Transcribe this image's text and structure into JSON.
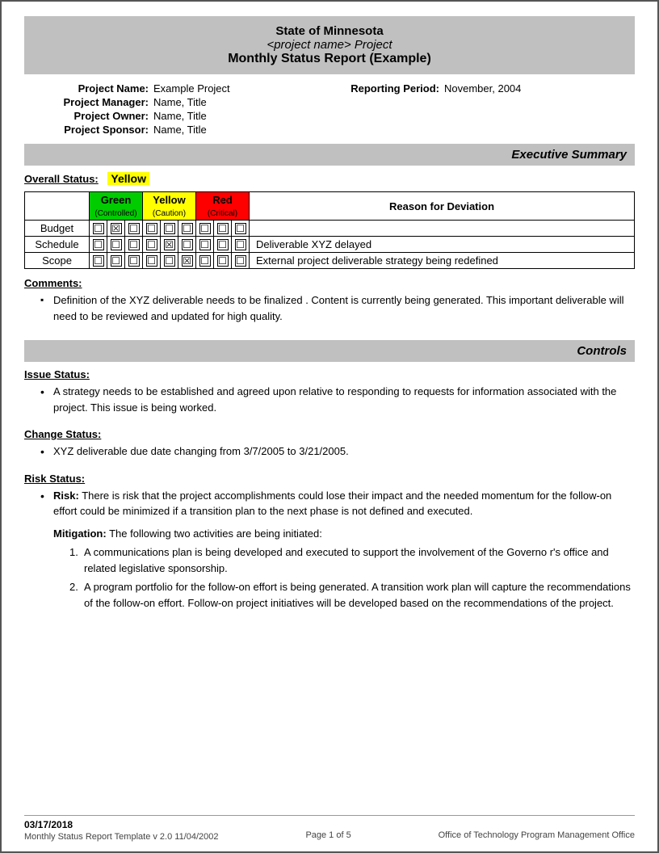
{
  "header": {
    "line1": "State of Minnesota",
    "line2": "<project name> Project",
    "line3": "Monthly Status Report (Example)"
  },
  "projectInfo": {
    "projectNameLabel": "Project Name:",
    "projectNameValue": "Example Project",
    "reportingPeriodLabel": "Reporting Period:",
    "reportingPeriodValue": "November, 2004",
    "projectManagerLabel": "Project Manager:",
    "projectManagerValue": "Name, Title",
    "projectOwnerLabel": "Project Owner:",
    "projectOwnerValue": "Name, Title",
    "projectSponsorLabel": "Project Sponsor:",
    "projectSponsorValue": "Name, Title"
  },
  "executiveSummary": {
    "sectionTitle": "Executive Summary",
    "overallStatusLabel": "Overall Status:",
    "overallStatusValue": "Yellow",
    "tableHeaders": {
      "green": "Green",
      "greenSub": "(Controlled)",
      "yellow": "Yellow",
      "yellowSub": "(Caution)",
      "red": "Red",
      "redSub": "(Critical)",
      "reason": "Reason for Deviation"
    },
    "rows": [
      {
        "label": "Budget",
        "green": [
          false,
          true,
          false
        ],
        "yellow": [
          false,
          false,
          false
        ],
        "red": [
          false,
          false,
          false
        ],
        "reason": ""
      },
      {
        "label": "Schedule",
        "green": [
          false,
          false,
          false
        ],
        "yellow": [
          false,
          true,
          false
        ],
        "red": [
          false,
          false,
          false
        ],
        "reason": "Deliverable XYZ delayed"
      },
      {
        "label": "Scope",
        "green": [
          false,
          false,
          false
        ],
        "yellow": [
          false,
          false,
          true
        ],
        "red": [
          false,
          false,
          false
        ],
        "reason": "External project deliverable strategy being redefined"
      }
    ],
    "commentsLabel": "Comments:",
    "commentText": "Definition of the XYZ deliverable  needs to be finalized .  Content is currently being generated.  This important deliverable will need to be reviewed and updated for high quality."
  },
  "controls": {
    "sectionTitle": "Controls",
    "issueStatusLabel": "Issue Status:",
    "issueText": "A strategy needs to be established and agreed upon relative to  responding to  requests for information associated with the project.  This issue is being worked.",
    "changeStatusLabel": "Change Status:",
    "changeText": "XYZ  deliverable due date changing from   3/7/2005 to 3/21/2005.",
    "riskStatusLabel": "Risk Status:",
    "riskLabel": "Risk:",
    "riskText": "There is risk that the project accomplishments could lose their impact and the needed momentum for the follow-on effort could be   minimized if a transition plan to the next phase is not defined and executed.",
    "mitigationLabel": "Mitigation:",
    "mitigationIntro": "The following two activities are being initiated:",
    "mitigationItems": [
      "A communications plan is being developed and executed to support the involvement of the Governo r's office and related legislative sponsorship.",
      "A program portfolio for the follow-on effort is being generated.  A transition work plan will capture the recommendations of the follow-on effort. Follow-on project initiatives will be developed based on the recommendations of the project."
    ]
  },
  "footer": {
    "date": "03/17/2018",
    "templateInfo": "Monthly Status Report Template  v 2.0  11/04/2002",
    "pageLabel": "Page 1 of 5",
    "office": "Office of Technology Program Management Office"
  }
}
